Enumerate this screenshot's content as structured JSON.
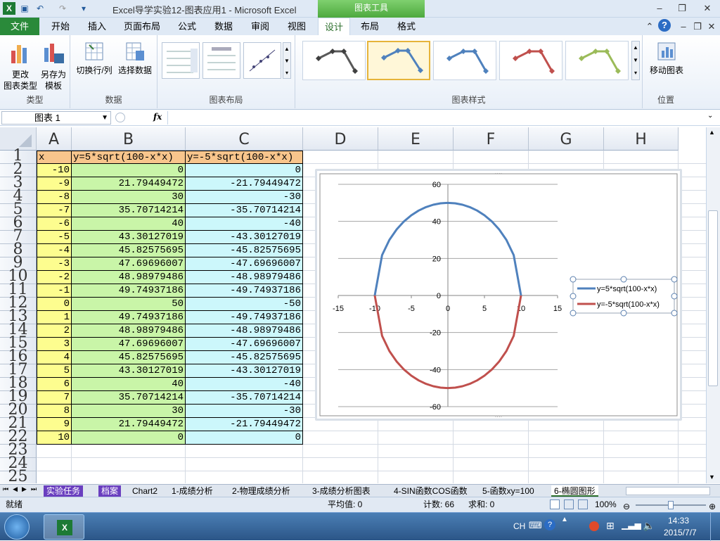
{
  "window": {
    "title": "Excel导学实验12-图表应用1 - Microsoft Excel",
    "context_header": "图表工具"
  },
  "tabs": [
    "文件",
    "开始",
    "插入",
    "页面布局",
    "公式",
    "数据",
    "审阅",
    "视图",
    "设计",
    "布局",
    "格式"
  ],
  "ribbon": {
    "groups": [
      {
        "label": "类型"
      },
      {
        "label": "数据"
      },
      {
        "label": "图表布局"
      },
      {
        "label": "图表样式"
      },
      {
        "label": "位置"
      }
    ],
    "buttons": {
      "change_type": "更改\n图表类型",
      "save_template": "另存为\n模板",
      "switch_rowcol": "切换行/列",
      "select_data": "选择数据",
      "move_chart": "移动图表"
    }
  },
  "formula_bar": {
    "name_box": "图表 1",
    "fx": "fx",
    "formula": ""
  },
  "columns": [
    "A",
    "B",
    "C",
    "D",
    "E",
    "F",
    "G",
    "H"
  ],
  "rows": [
    "1",
    "2",
    "3",
    "4",
    "5",
    "6",
    "7",
    "8",
    "9",
    "10",
    "11",
    "12",
    "13",
    "14",
    "15",
    "16",
    "17",
    "18",
    "19",
    "20",
    "21",
    "22",
    "23",
    "24",
    "25"
  ],
  "header_row": [
    "x",
    "y=5*sqrt(100-x*x)",
    "y=-5*sqrt(100-x*x)"
  ],
  "table": [
    [
      "-10",
      "0",
      "0"
    ],
    [
      "-9",
      "21.79449472",
      "-21.79449472"
    ],
    [
      "-8",
      "30",
      "-30"
    ],
    [
      "-7",
      "35.70714214",
      "-35.70714214"
    ],
    [
      "-6",
      "40",
      "-40"
    ],
    [
      "-5",
      "43.30127019",
      "-43.30127019"
    ],
    [
      "-4",
      "45.82575695",
      "-45.82575695"
    ],
    [
      "-3",
      "47.69696007",
      "-47.69696007"
    ],
    [
      "-2",
      "48.98979486",
      "-48.98979486"
    ],
    [
      "-1",
      "49.74937186",
      "-49.74937186"
    ],
    [
      "0",
      "50",
      "-50"
    ],
    [
      "1",
      "49.74937186",
      "-49.74937186"
    ],
    [
      "2",
      "48.98979486",
      "-48.98979486"
    ],
    [
      "3",
      "47.69696007",
      "-47.69696007"
    ],
    [
      "4",
      "45.82575695",
      "-45.82575695"
    ],
    [
      "5",
      "43.30127019",
      "-43.30127019"
    ],
    [
      "6",
      "40",
      "-40"
    ],
    [
      "7",
      "35.70714214",
      "-35.70714214"
    ],
    [
      "8",
      "30",
      "-30"
    ],
    [
      "9",
      "21.79449472",
      "-21.79449472"
    ],
    [
      "10",
      "0",
      "0"
    ]
  ],
  "chart_data": {
    "type": "line",
    "xlim": [
      -15,
      15
    ],
    "ylim": [
      -60,
      60
    ],
    "xticks": [
      "-15",
      "-10",
      "-5",
      "0",
      "5",
      "10",
      "15"
    ],
    "yticks": [
      "60",
      "40",
      "20",
      "0",
      "-20",
      "-40",
      "-60"
    ],
    "grid": true,
    "legend": "right",
    "x": [
      -10,
      -9,
      -8,
      -7,
      -6,
      -5,
      -4,
      -3,
      -2,
      -1,
      0,
      1,
      2,
      3,
      4,
      5,
      6,
      7,
      8,
      9,
      10
    ],
    "series": [
      {
        "name": "y=5*sqrt(100-x*x)",
        "color": "#4f81bd",
        "values": [
          0,
          21.79,
          30,
          35.71,
          40,
          43.3,
          45.83,
          47.7,
          48.99,
          49.75,
          50,
          49.75,
          48.99,
          47.7,
          45.83,
          43.3,
          40,
          35.71,
          30,
          21.79,
          0
        ]
      },
      {
        "name": "y=-5*sqrt(100-x*x)",
        "color": "#c0504d",
        "values": [
          0,
          -21.79,
          -30,
          -35.71,
          -40,
          -43.3,
          -45.83,
          -47.7,
          -48.99,
          -49.75,
          -50,
          -49.75,
          -48.99,
          -47.7,
          -45.83,
          -43.3,
          -40,
          -35.71,
          -30,
          -21.79,
          0
        ]
      }
    ]
  },
  "sheet_tabs": [
    "实验任务",
    "档案",
    "Chart2",
    "1-成绩分析",
    "2-物理成绩分析",
    "3-成绩分析图表",
    "4-SIN函数COS函数",
    "5-函数xy=100",
    "6-椭圆图形"
  ],
  "status": {
    "ready": "就绪",
    "average": "平均值: 0",
    "count": "计数: 66",
    "sum": "求和: 0",
    "zoom": "100%"
  },
  "taskbar": {
    "lang": "CH",
    "time": "14:33",
    "date": "2015/7/7"
  }
}
